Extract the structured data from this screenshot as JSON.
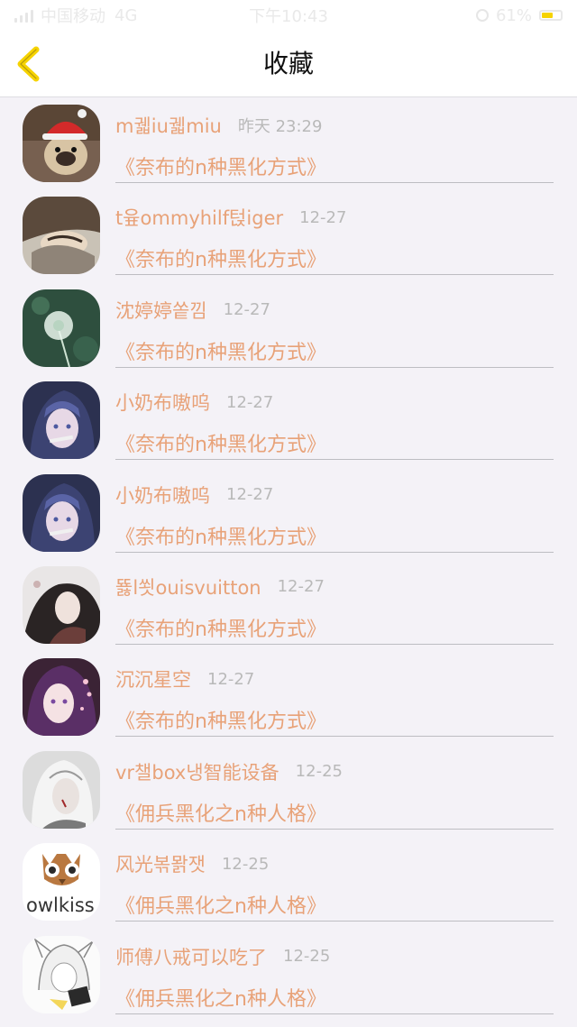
{
  "status_bar": {
    "carrier": "中国移动",
    "network": "4G",
    "time": "下午10:43",
    "battery_text": "61%",
    "battery_level": 0.61,
    "battery_color": "#f6d300"
  },
  "header": {
    "back_icon": "chevron-left-icon",
    "back_color": "#f6d300",
    "title": "收藏"
  },
  "colors": {
    "accent": "#e8a278",
    "muted": "#b9b9b9",
    "background": "#f4f2f7"
  },
  "favorites": [
    {
      "user": "m궯iu궯miu",
      "date": "昨天 23:29",
      "article": "《奈布的n种黑化方式》",
      "avatar": "pug-santa-hat"
    },
    {
      "user": "t윺ommyhilf턵iger",
      "date": "12-27",
      "article": "《奈布的n种黑化方式》",
      "avatar": "sleeping-character"
    },
    {
      "user": "沈婷婷쏱낌",
      "date": "12-27",
      "article": "《奈布的n种黑化方式》",
      "avatar": "dandelion"
    },
    {
      "user": "小奶布嗷呜",
      "date": "12-27",
      "article": "《奈布的n种黑化方式》",
      "avatar": "anime-hooded-character"
    },
    {
      "user": "小奶布嗷呜",
      "date": "12-27",
      "article": "《奈布的n种黑化方式》",
      "avatar": "anime-hooded-character"
    },
    {
      "user": "뚏l쐿ouisvuitton",
      "date": "12-27",
      "article": "《奈布的n种黑化方式》",
      "avatar": "dark-haired-character"
    },
    {
      "user": "沉沉星空",
      "date": "12-27",
      "article": "《奈布的n种黑化方式》",
      "avatar": "purple-haired-anime-girl"
    },
    {
      "user": "vr챌box냉智能设备",
      "date": "12-25",
      "article": "《佣兵黑化之n种人格》",
      "avatar": "white-haired-character"
    },
    {
      "user": "风光볶뫍잿",
      "date": "12-25",
      "article": "《佣兵黑化之n种人格》",
      "avatar": "owlkiss-logo",
      "avatar_text": "owlkiss"
    },
    {
      "user": "师傅八戒可以吃了",
      "date": "12-25",
      "article": "《佣兵黑化之n种人格》",
      "avatar": "sketch-character"
    }
  ]
}
